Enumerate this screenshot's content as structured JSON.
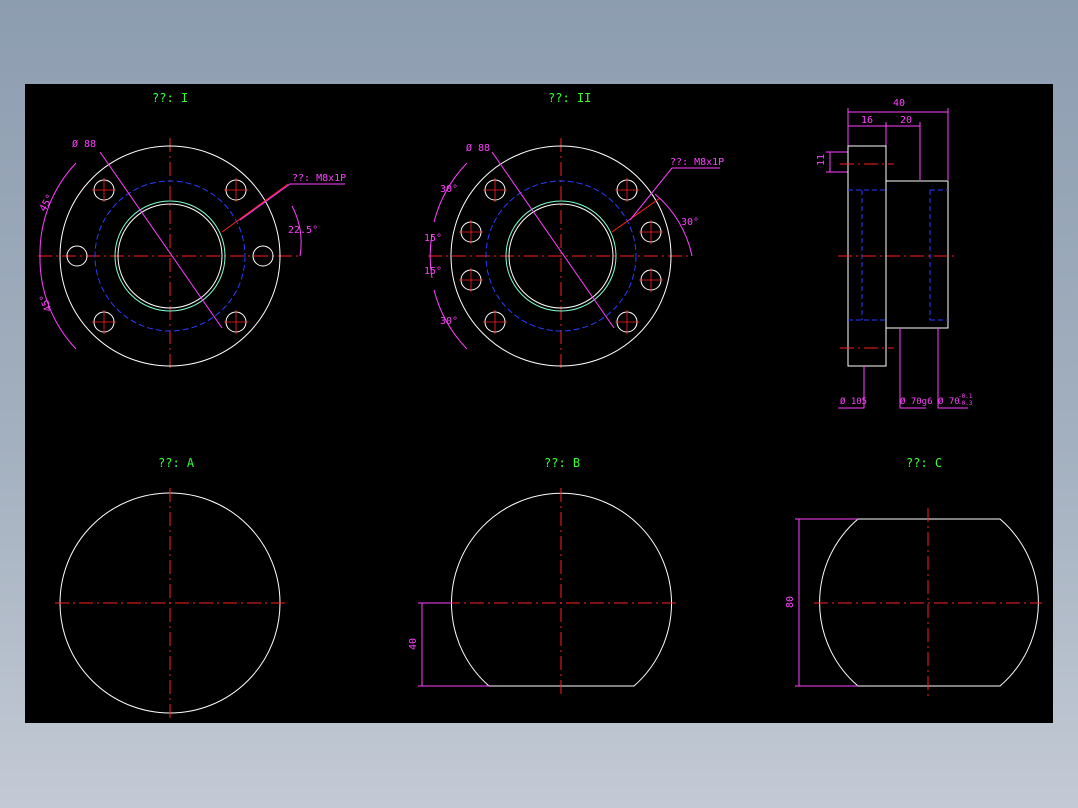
{
  "colors": {
    "background": "#000000",
    "outline": "#ffffff",
    "centerline": "#ff2020",
    "hidden": "#2a3cff",
    "thread": "#7fffd4",
    "dimension": "#ff40ff",
    "title": "#33ff33"
  },
  "views": {
    "view1": {
      "title": "??: I"
    },
    "view2": {
      "title": "??: II"
    },
    "viewA": {
      "title": "??: A"
    },
    "viewB": {
      "title": "??: B"
    },
    "viewC": {
      "title": "??: C"
    }
  },
  "dims": {
    "v1_pcd": "Ø 88",
    "v1_angle_top": "45°",
    "v1_angle_bottom": "45°",
    "v1_thread": "??: M8x1P",
    "v1_angle_right": "22.5°",
    "v2_pcd": "Ø 88",
    "v2_angle_top": "30°",
    "v2_angle_mid1": "15°",
    "v2_angle_mid2": "15°",
    "v2_angle_bottom": "30°",
    "v2_thread": "??: M8x1P",
    "v2_angle_right": "30°",
    "side_total": "40",
    "side_flange": "16",
    "side_body": "20",
    "side_offset": "11",
    "side_d1": "Ø 105",
    "side_d2": "Ø 70g6",
    "side_d3": "Ø 70",
    "side_tol_upper": "-0.1",
    "side_tol_lower": "-0.3",
    "b_height": "40",
    "c_height": "80"
  }
}
